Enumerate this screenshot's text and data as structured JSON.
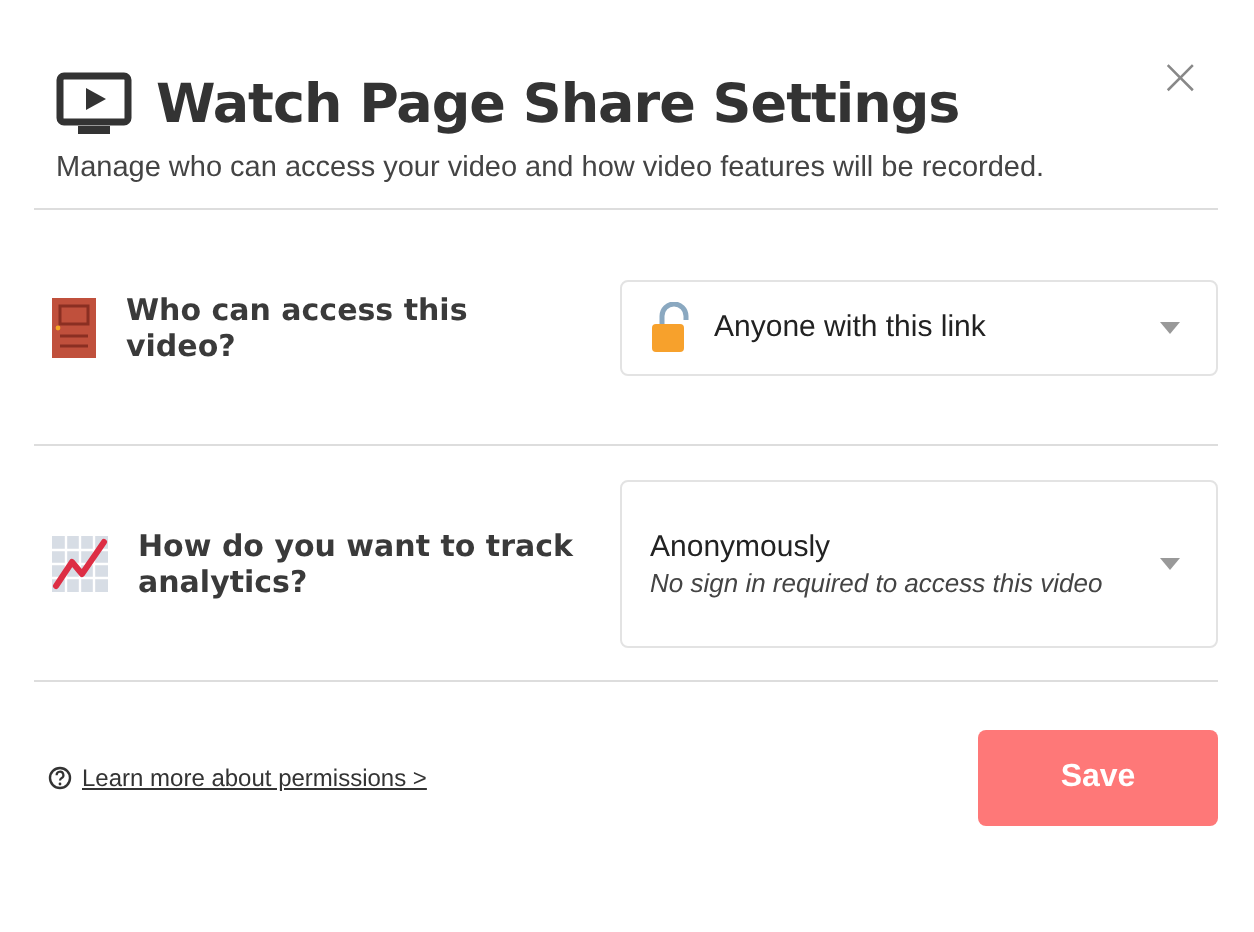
{
  "dialog": {
    "title": "Watch Page Share Settings",
    "subtitle": "Manage who can access your video and how video features will be recorded.",
    "close": "×"
  },
  "settings": [
    {
      "kind": "access",
      "question": "Who can access this video?",
      "value": "Anyone with this link"
    },
    {
      "kind": "analytics",
      "question": "How do you want to track analytics?",
      "value": "Anonymously",
      "description": "No sign in required to access this video"
    }
  ],
  "footer": {
    "help_link": "Learn more about permissions >",
    "save": "Save"
  }
}
